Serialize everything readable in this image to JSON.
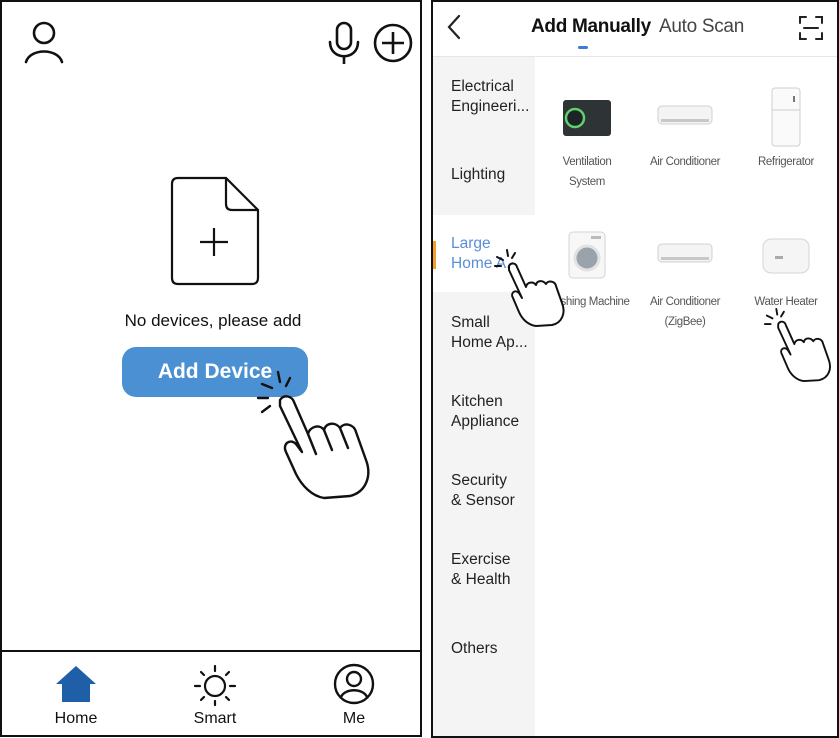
{
  "left": {
    "empty_text": "No devices, please add",
    "add_button": "Add Device",
    "nav": {
      "home": "Home",
      "smart": "Smart",
      "me": "Me"
    },
    "colors": {
      "accent": "#4a90d2",
      "home_active": "#1f5fa8"
    },
    "icons": [
      "user-icon",
      "microphone-icon",
      "plus-circle-icon",
      "add-document-icon",
      "home-icon",
      "sun-icon",
      "profile-icon",
      "pointing-hand-icon"
    ]
  },
  "right": {
    "tabs": {
      "manual": "Add Manually",
      "scan": "Auto Scan"
    },
    "categories": [
      {
        "label": "Electrical\nEngineeri..."
      },
      {
        "label": "Lighting"
      },
      {
        "label": "Large\nHome A..."
      },
      {
        "label": "Small\nHome Ap..."
      },
      {
        "label": "Kitchen\nAppliance"
      },
      {
        "label": "Security\n& Sensor"
      },
      {
        "label": "Exercise\n& Health"
      },
      {
        "label": "Others"
      }
    ],
    "active_category": "Large Home Appliances",
    "devices_row1": [
      {
        "label": "Ventilation\nSystem"
      },
      {
        "label": "Air Conditioner"
      },
      {
        "label": "Refrigerator"
      }
    ],
    "devices_row2": [
      {
        "label": "Washing Machine"
      },
      {
        "label": "Air Conditioner\n(ZigBee)"
      },
      {
        "label": "Water Heater"
      }
    ],
    "colors": {
      "active_text": "#5a8fd8",
      "active_mark": "#f2a02b",
      "tab_indicator": "#3d7bd8"
    }
  }
}
